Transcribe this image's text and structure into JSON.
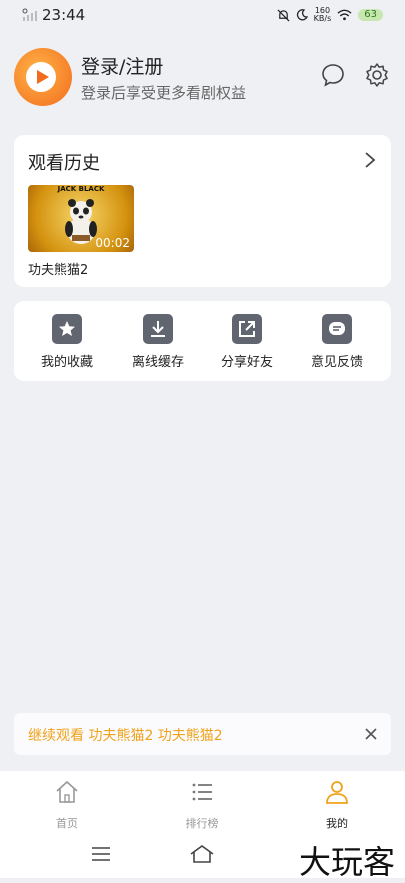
{
  "status": {
    "time": "23:44",
    "net_speed_value": "160",
    "net_speed_unit": "KB/s",
    "battery": "63"
  },
  "header": {
    "title": "登录/注册",
    "subtitle": "登录后享受更多看剧权益"
  },
  "history": {
    "title": "观看历史",
    "items": [
      {
        "poster_text": "JACK BLACK",
        "duration": "00:02",
        "name": "功夫熊猫2"
      }
    ]
  },
  "tools": [
    {
      "label": "我的收藏",
      "icon": "star-icon"
    },
    {
      "label": "离线缓存",
      "icon": "download-icon"
    },
    {
      "label": "分享好友",
      "icon": "share-icon"
    },
    {
      "label": "意见反馈",
      "icon": "feedback-icon"
    }
  ],
  "continue_watching": {
    "text": "继续观看 功夫熊猫2 功夫熊猫2"
  },
  "bottom_nav": [
    {
      "label": "首页",
      "icon": "home-icon",
      "active": false
    },
    {
      "label": "排行榜",
      "icon": "list-icon",
      "active": false
    },
    {
      "label": "我的",
      "icon": "user-icon",
      "active": true
    }
  ],
  "watermark": "大玩客",
  "colors": {
    "accent": "#f0a21a",
    "background": "#eef0f4",
    "tool_icon_bg": "#606570"
  }
}
